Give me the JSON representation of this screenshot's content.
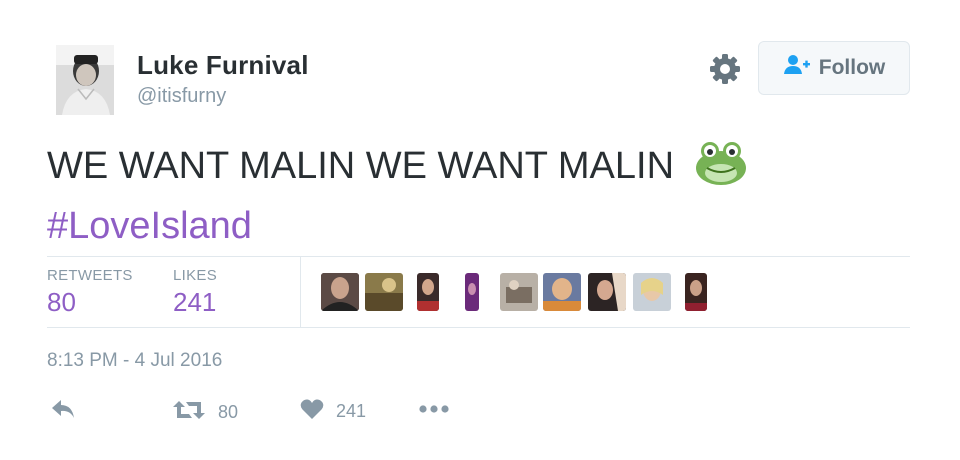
{
  "user": {
    "display_name": "Luke Furnival",
    "handle": "@itisfurny"
  },
  "follow_button": {
    "label": "Follow"
  },
  "tweet": {
    "text": "WE WANT MALIN WE WANT MALIN",
    "emoji": "frog-face",
    "hashtag": "#LoveIsland"
  },
  "stats": {
    "retweets_label": "RETWEETS",
    "retweets_count": "80",
    "likes_label": "LIKES",
    "likes_count": "241"
  },
  "timestamp": "8:13 PM - 4 Jul 2016",
  "actions": {
    "retweet_count": "80",
    "like_count": "241"
  },
  "colors": {
    "accent": "#8e5ec5",
    "muted": "#8899a6",
    "text": "#292f33",
    "follow_icon": "#1da1f2"
  },
  "icons": [
    "gear-icon",
    "follow-person-icon",
    "reply-icon",
    "retweet-icon",
    "heart-icon",
    "more-icon",
    "frog-emoji"
  ]
}
